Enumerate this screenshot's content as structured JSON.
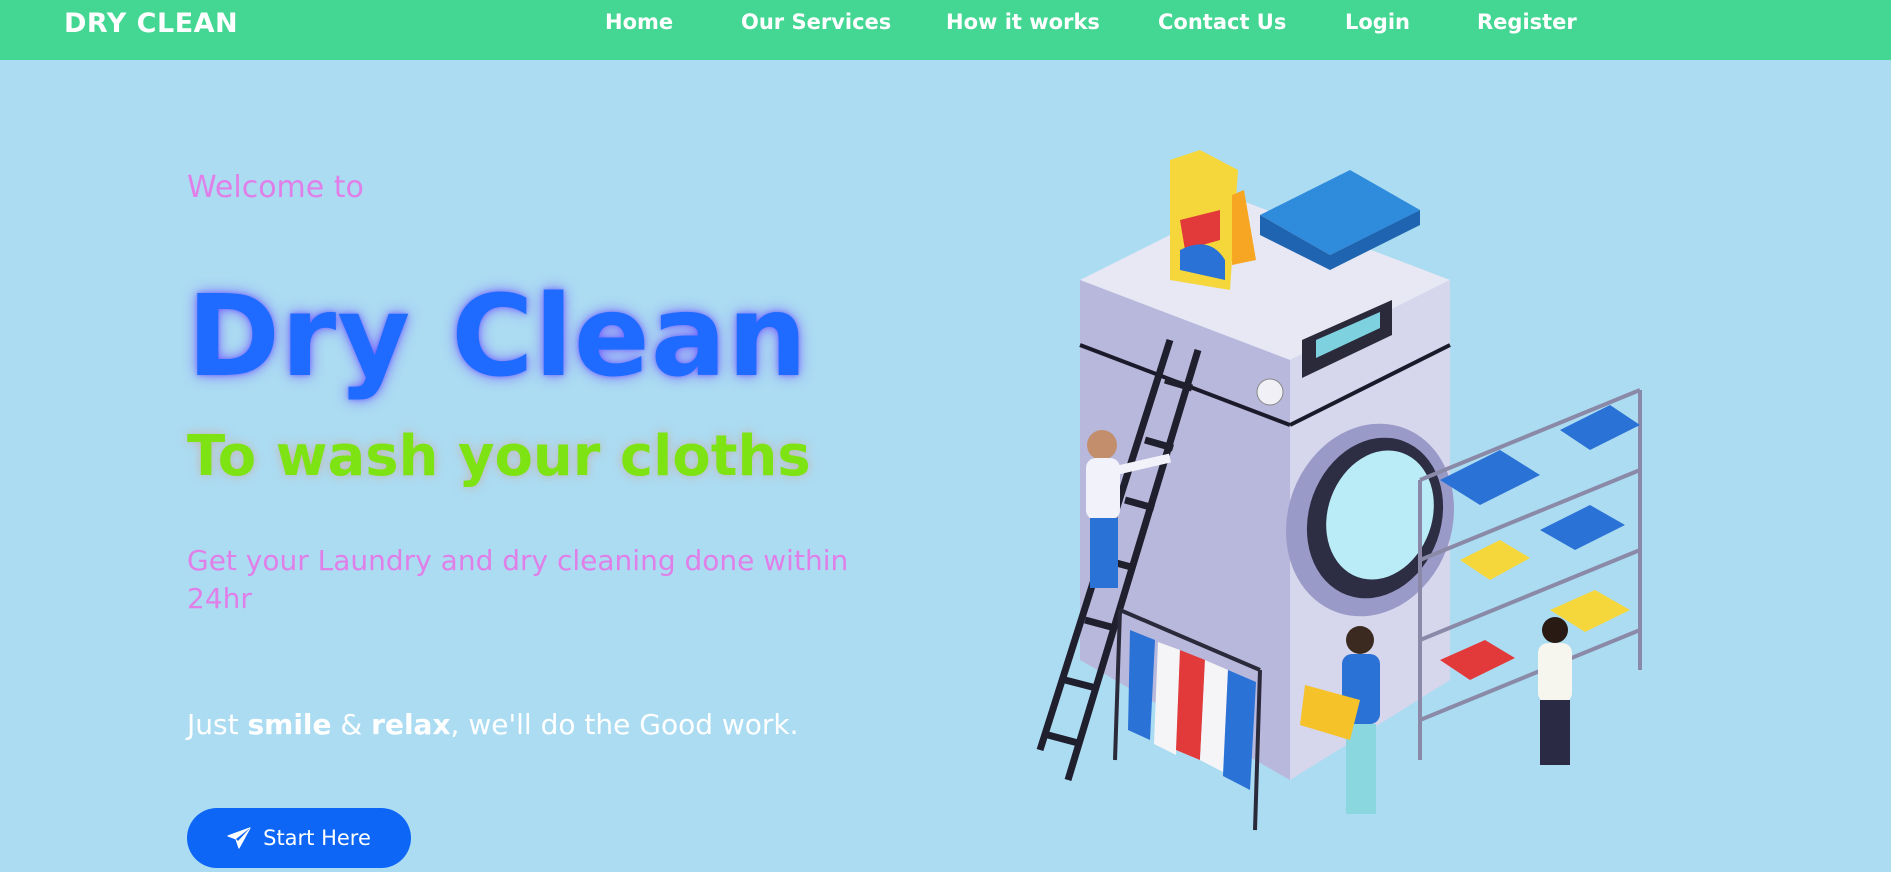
{
  "navbar": {
    "brand": "DRY CLEAN",
    "links": [
      {
        "label": "Home"
      },
      {
        "label": "Our Services"
      },
      {
        "label": "How it works"
      },
      {
        "label": "Contact Us"
      },
      {
        "label": "Login"
      },
      {
        "label": "Register"
      }
    ]
  },
  "hero": {
    "welcome": "Welcome to",
    "title": "Dry Clean",
    "subtitle": "To wash your cloths",
    "tagline": "Get your Laundry and dry cleaning done within 24hr",
    "relax": {
      "part1": "Just ",
      "smile": "smile",
      "part2": " & ",
      "relax": "relax",
      "part3": ", we'll do the Good work."
    },
    "button": {
      "label": "Start Here",
      "icon": "paper-plane-icon"
    }
  },
  "illustration": {
    "name": "laundry-isometric-illustration"
  },
  "colors": {
    "background": "#acdcf2",
    "navbar": "#44d793",
    "title": "#1f6bff",
    "subtitle": "#7ee313",
    "accent_pink": "#e07fe8",
    "button": "#0d66f6"
  }
}
